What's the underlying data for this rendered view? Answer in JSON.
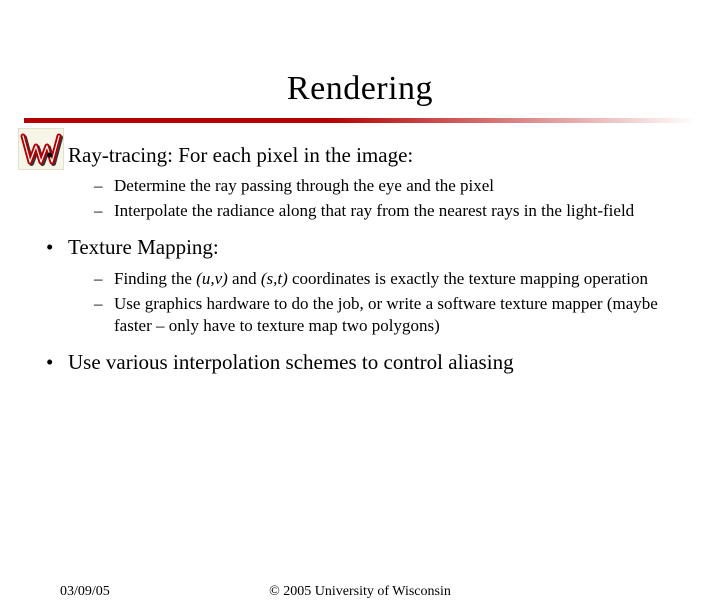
{
  "title": "Rendering",
  "bullets": {
    "b1": "Ray-tracing: For each pixel in the image:",
    "b1_sub1": "Determine the ray passing through the eye and the pixel",
    "b1_sub2": "Interpolate the radiance along that ray from the nearest rays in the light-field",
    "b2": "Texture Mapping:",
    "b2_sub1_a": "Finding the ",
    "b2_sub1_uv": "(u,v)",
    "b2_sub1_b": " and ",
    "b2_sub1_st": "(s,t)",
    "b2_sub1_c": " coordinates is exactly the texture mapping operation",
    "b2_sub2": "Use graphics hardware to do the job, or write a software texture mapper (maybe faster – only have to texture map two polygons)",
    "b3": "Use various interpolation schemes to control aliasing"
  },
  "footer": {
    "date": "03/09/05",
    "copyright": "© 2005 University of Wisconsin"
  },
  "logo": {
    "letter": "W",
    "stroke": "#b40000",
    "shadow": "#333"
  }
}
